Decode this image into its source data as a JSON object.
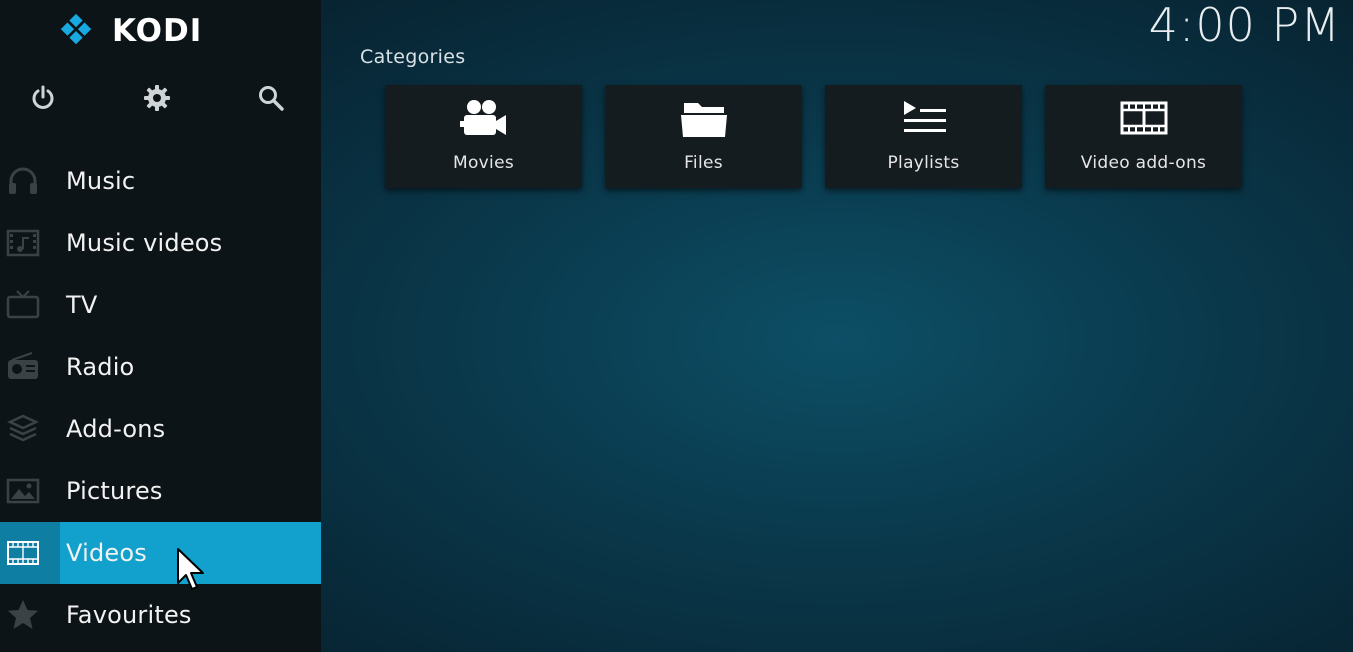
{
  "app": {
    "name": "KODI",
    "clock": "4:00 PM"
  },
  "top_icons": [
    "power-icon",
    "settings-icon",
    "search-icon"
  ],
  "menu": [
    {
      "label": "Music",
      "icon": "headphones-icon",
      "active": false
    },
    {
      "label": "Music videos",
      "icon": "music-video-icon",
      "active": false
    },
    {
      "label": "TV",
      "icon": "tv-icon",
      "active": false
    },
    {
      "label": "Radio",
      "icon": "radio-icon",
      "active": false
    },
    {
      "label": "Add-ons",
      "icon": "addons-box-icon",
      "active": false
    },
    {
      "label": "Pictures",
      "icon": "picture-icon",
      "active": false
    },
    {
      "label": "Videos",
      "icon": "film-icon",
      "active": true
    },
    {
      "label": "Favourites",
      "icon": "star-icon",
      "active": false
    }
  ],
  "main": {
    "section_title": "Categories",
    "tiles": [
      {
        "label": "Movies",
        "icon": "movie-camera-icon"
      },
      {
        "label": "Files",
        "icon": "folder-icon"
      },
      {
        "label": "Playlists",
        "icon": "playlist-icon"
      },
      {
        "label": "Video add-ons",
        "icon": "film-strip-icon"
      }
    ]
  },
  "colors": {
    "accent": "#12a0cc",
    "accent_dark": "#0e7fa2",
    "sidebar": "#0d1418",
    "tile": "#141c20",
    "logo_blue": "#17a9e0"
  }
}
